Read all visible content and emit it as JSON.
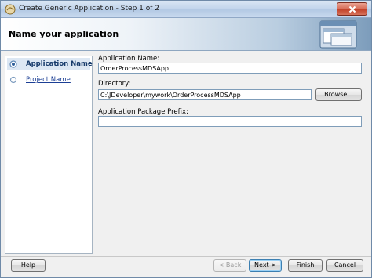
{
  "window": {
    "title": "Create Generic Application - Step 1 of 2"
  },
  "header": {
    "title": "Name your application"
  },
  "nav": {
    "items": [
      {
        "label": "Application Name",
        "selected": true
      },
      {
        "label": "Project Name",
        "selected": false
      }
    ]
  },
  "form": {
    "app_name_label": "Application Name:",
    "app_name_value": "OrderProcessMDSApp",
    "directory_label": "Directory:",
    "directory_value": "C:\\JDeveloper\\mywork\\OrderProcessMDSApp",
    "browse_label": "Browse...",
    "package_prefix_label": "Application Package Prefix:",
    "package_prefix_value": ""
  },
  "footer": {
    "help_label": "Help",
    "back_label": "< Back",
    "next_label": "Next >",
    "finish_label": "Finish",
    "cancel_label": "Cancel"
  },
  "colors": {
    "accent": "#163a6a",
    "link": "#1c3f95",
    "close": "#c2432b"
  }
}
